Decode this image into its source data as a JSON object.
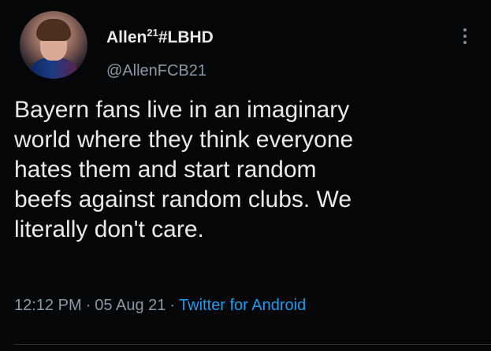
{
  "tweet": {
    "display_name": "Allen",
    "display_name_superscript": "21",
    "display_name_suffix": "#LBHD",
    "username": "@AllenFCB21",
    "text_lines": [
      "Bayern fans live in an imaginary",
      "world where they think everyone",
      "hates them and start random",
      "beefs against random clubs. We",
      "literally don't care."
    ],
    "time": "12:12 PM",
    "date": "05 Aug 21",
    "source": "Twitter for Android",
    "separator": "·",
    "more_icon": "more-vertical-icon"
  },
  "colors": {
    "background": "#050607",
    "text": "#e7e9ea",
    "secondary_text": "#8b98a5",
    "link": "#1d9bf0"
  }
}
